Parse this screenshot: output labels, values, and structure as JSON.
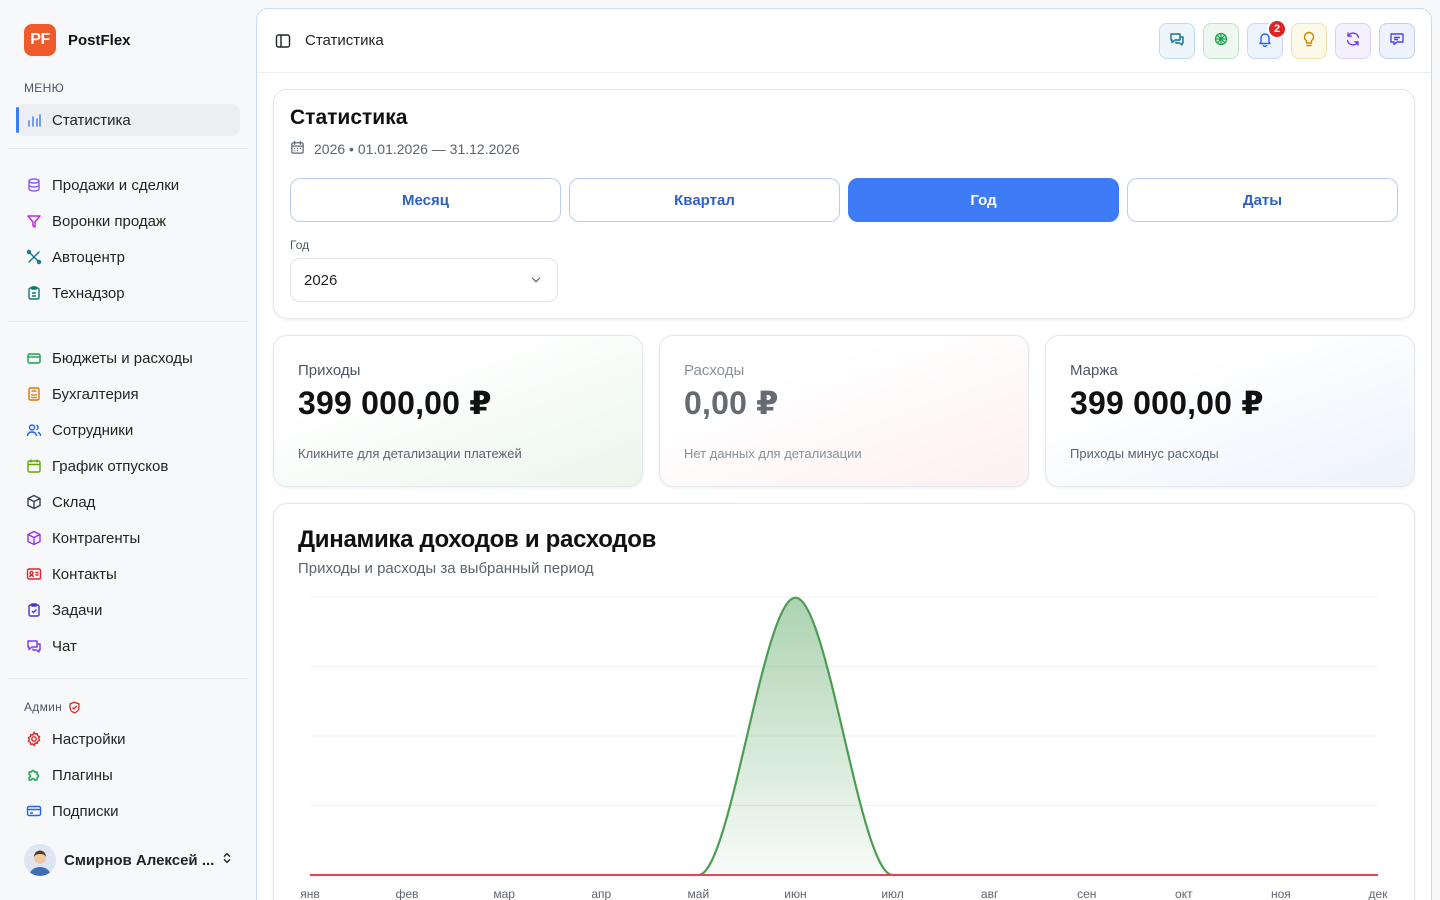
{
  "brand": {
    "logo": "PF",
    "name": "PostFlex"
  },
  "sidebar": {
    "menu_label": "МЕНЮ",
    "items": [
      {
        "label": "Статистика",
        "icon": "bar-chart-icon",
        "active": true
      },
      {
        "label": "Продажи и сделки",
        "icon": "database-icon"
      },
      {
        "label": "Воронки продаж",
        "icon": "funnel-icon"
      },
      {
        "label": "Автоцентр",
        "icon": "wrench-icon"
      },
      {
        "label": "Технадзор",
        "icon": "clipboard-icon"
      },
      {
        "label": "Бюджеты и расходы",
        "icon": "wallet-icon"
      },
      {
        "label": "Бухгалтерия",
        "icon": "calculator-icon"
      },
      {
        "label": "Сотрудники",
        "icon": "users-icon"
      },
      {
        "label": "График отпусков",
        "icon": "calendar-icon"
      },
      {
        "label": "Склад",
        "icon": "box-icon"
      },
      {
        "label": "Контрагенты",
        "icon": "package-icon"
      },
      {
        "label": "Контакты",
        "icon": "contact-card-icon"
      },
      {
        "label": "Задачи",
        "icon": "tasks-icon"
      },
      {
        "label": "Чат",
        "icon": "chat-icon"
      }
    ],
    "admin_label": "Админ",
    "admin_items": [
      {
        "label": "Настройки",
        "icon": "settings-icon"
      },
      {
        "label": "Плагины",
        "icon": "puzzle-icon"
      },
      {
        "label": "Подписки",
        "icon": "credit-card-icon"
      }
    ],
    "user_name": "Смирнов Алексей ..."
  },
  "topbar": {
    "breadcrumb": "Статистика",
    "notifications_count": "2"
  },
  "stats": {
    "title": "Статистика",
    "period": "2026 • 01.01.2026 — 31.12.2026",
    "tabs": [
      "Месяц",
      "Квартал",
      "Год",
      "Даты"
    ],
    "active_tab": "Год",
    "year_label": "Год",
    "year_value": "2026"
  },
  "kpis": [
    {
      "label": "Приходы",
      "value": "399 000,00 ₽",
      "hint": "Кликните для детализации платежей"
    },
    {
      "label": "Расходы",
      "value": "0,00 ₽",
      "hint": "Нет данных для детализации"
    },
    {
      "label": "Маржа",
      "value": "399 000,00 ₽",
      "hint": "Приходы минус расходы"
    }
  ],
  "colors": {
    "accent": "#3d7bf7",
    "income": "#4a9d52",
    "expense": "#e0475a",
    "brand": "#f05a2a"
  },
  "chart": {
    "title": "Динамика доходов и расходов",
    "subtitle": "Приходы и расходы за выбранный период"
  },
  "chart_data": {
    "type": "area",
    "categories": [
      "янв",
      "фев",
      "мар",
      "апр",
      "май",
      "июн",
      "июл",
      "авг",
      "сен",
      "окт",
      "ноя",
      "дек"
    ],
    "series": [
      {
        "values": [
          0,
          0,
          0,
          0,
          0,
          399000,
          0,
          0,
          0,
          0,
          0,
          0
        ],
        "color": "#4a9d52"
      },
      {
        "values": [
          0,
          0,
          0,
          0,
          0,
          0,
          0,
          0,
          0,
          0,
          0,
          0
        ],
        "color": "#e0475a"
      }
    ],
    "ylim": [
      0,
      400000
    ],
    "grid": true
  }
}
